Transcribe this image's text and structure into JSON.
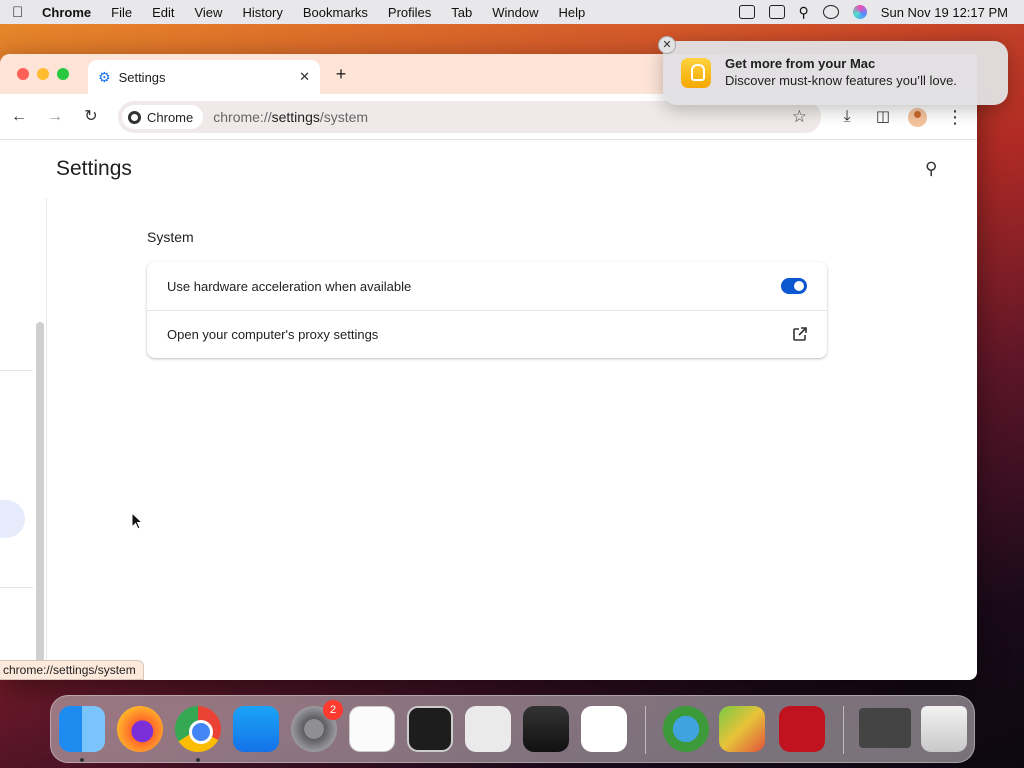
{
  "menubar": {
    "app_name": "Chrome",
    "items": [
      "File",
      "Edit",
      "View",
      "History",
      "Bookmarks",
      "Profiles",
      "Tab",
      "Window",
      "Help"
    ],
    "clock": "Sun Nov 19  12:17 PM"
  },
  "notification": {
    "title": "Get more from your Mac",
    "body": "Discover must-know features you’ll love.",
    "icon": "lightbulb-icon"
  },
  "browser": {
    "tab_title": "Settings",
    "omnibox": {
      "chip_label": "Chrome",
      "url_prefix": "chrome://",
      "url_host": "settings",
      "url_path": "/system"
    },
    "status_url": "chrome://settings/system"
  },
  "settings": {
    "page_title": "Settings",
    "section_title": "System",
    "rows": [
      {
        "label": "Use hardware acceleration when available",
        "control": "toggle",
        "enabled": true
      },
      {
        "label": "Open your computer's proxy settings",
        "control": "external-link"
      }
    ]
  },
  "dock": {
    "apps": [
      "Finder",
      "Firefox",
      "Google Chrome",
      "App Store",
      "System Settings",
      "TextEdit",
      "Terminal",
      "Launchpad",
      "GarageBand",
      "Visual Studio Code",
      "Game",
      "Game",
      "Photo Booth",
      "Hand Mirror",
      "Trash"
    ],
    "settings_badge": "2"
  },
  "colors": {
    "accent": "#0b57d0",
    "tabstrip": "#fde4d7",
    "omnibox": "#efeae9"
  }
}
